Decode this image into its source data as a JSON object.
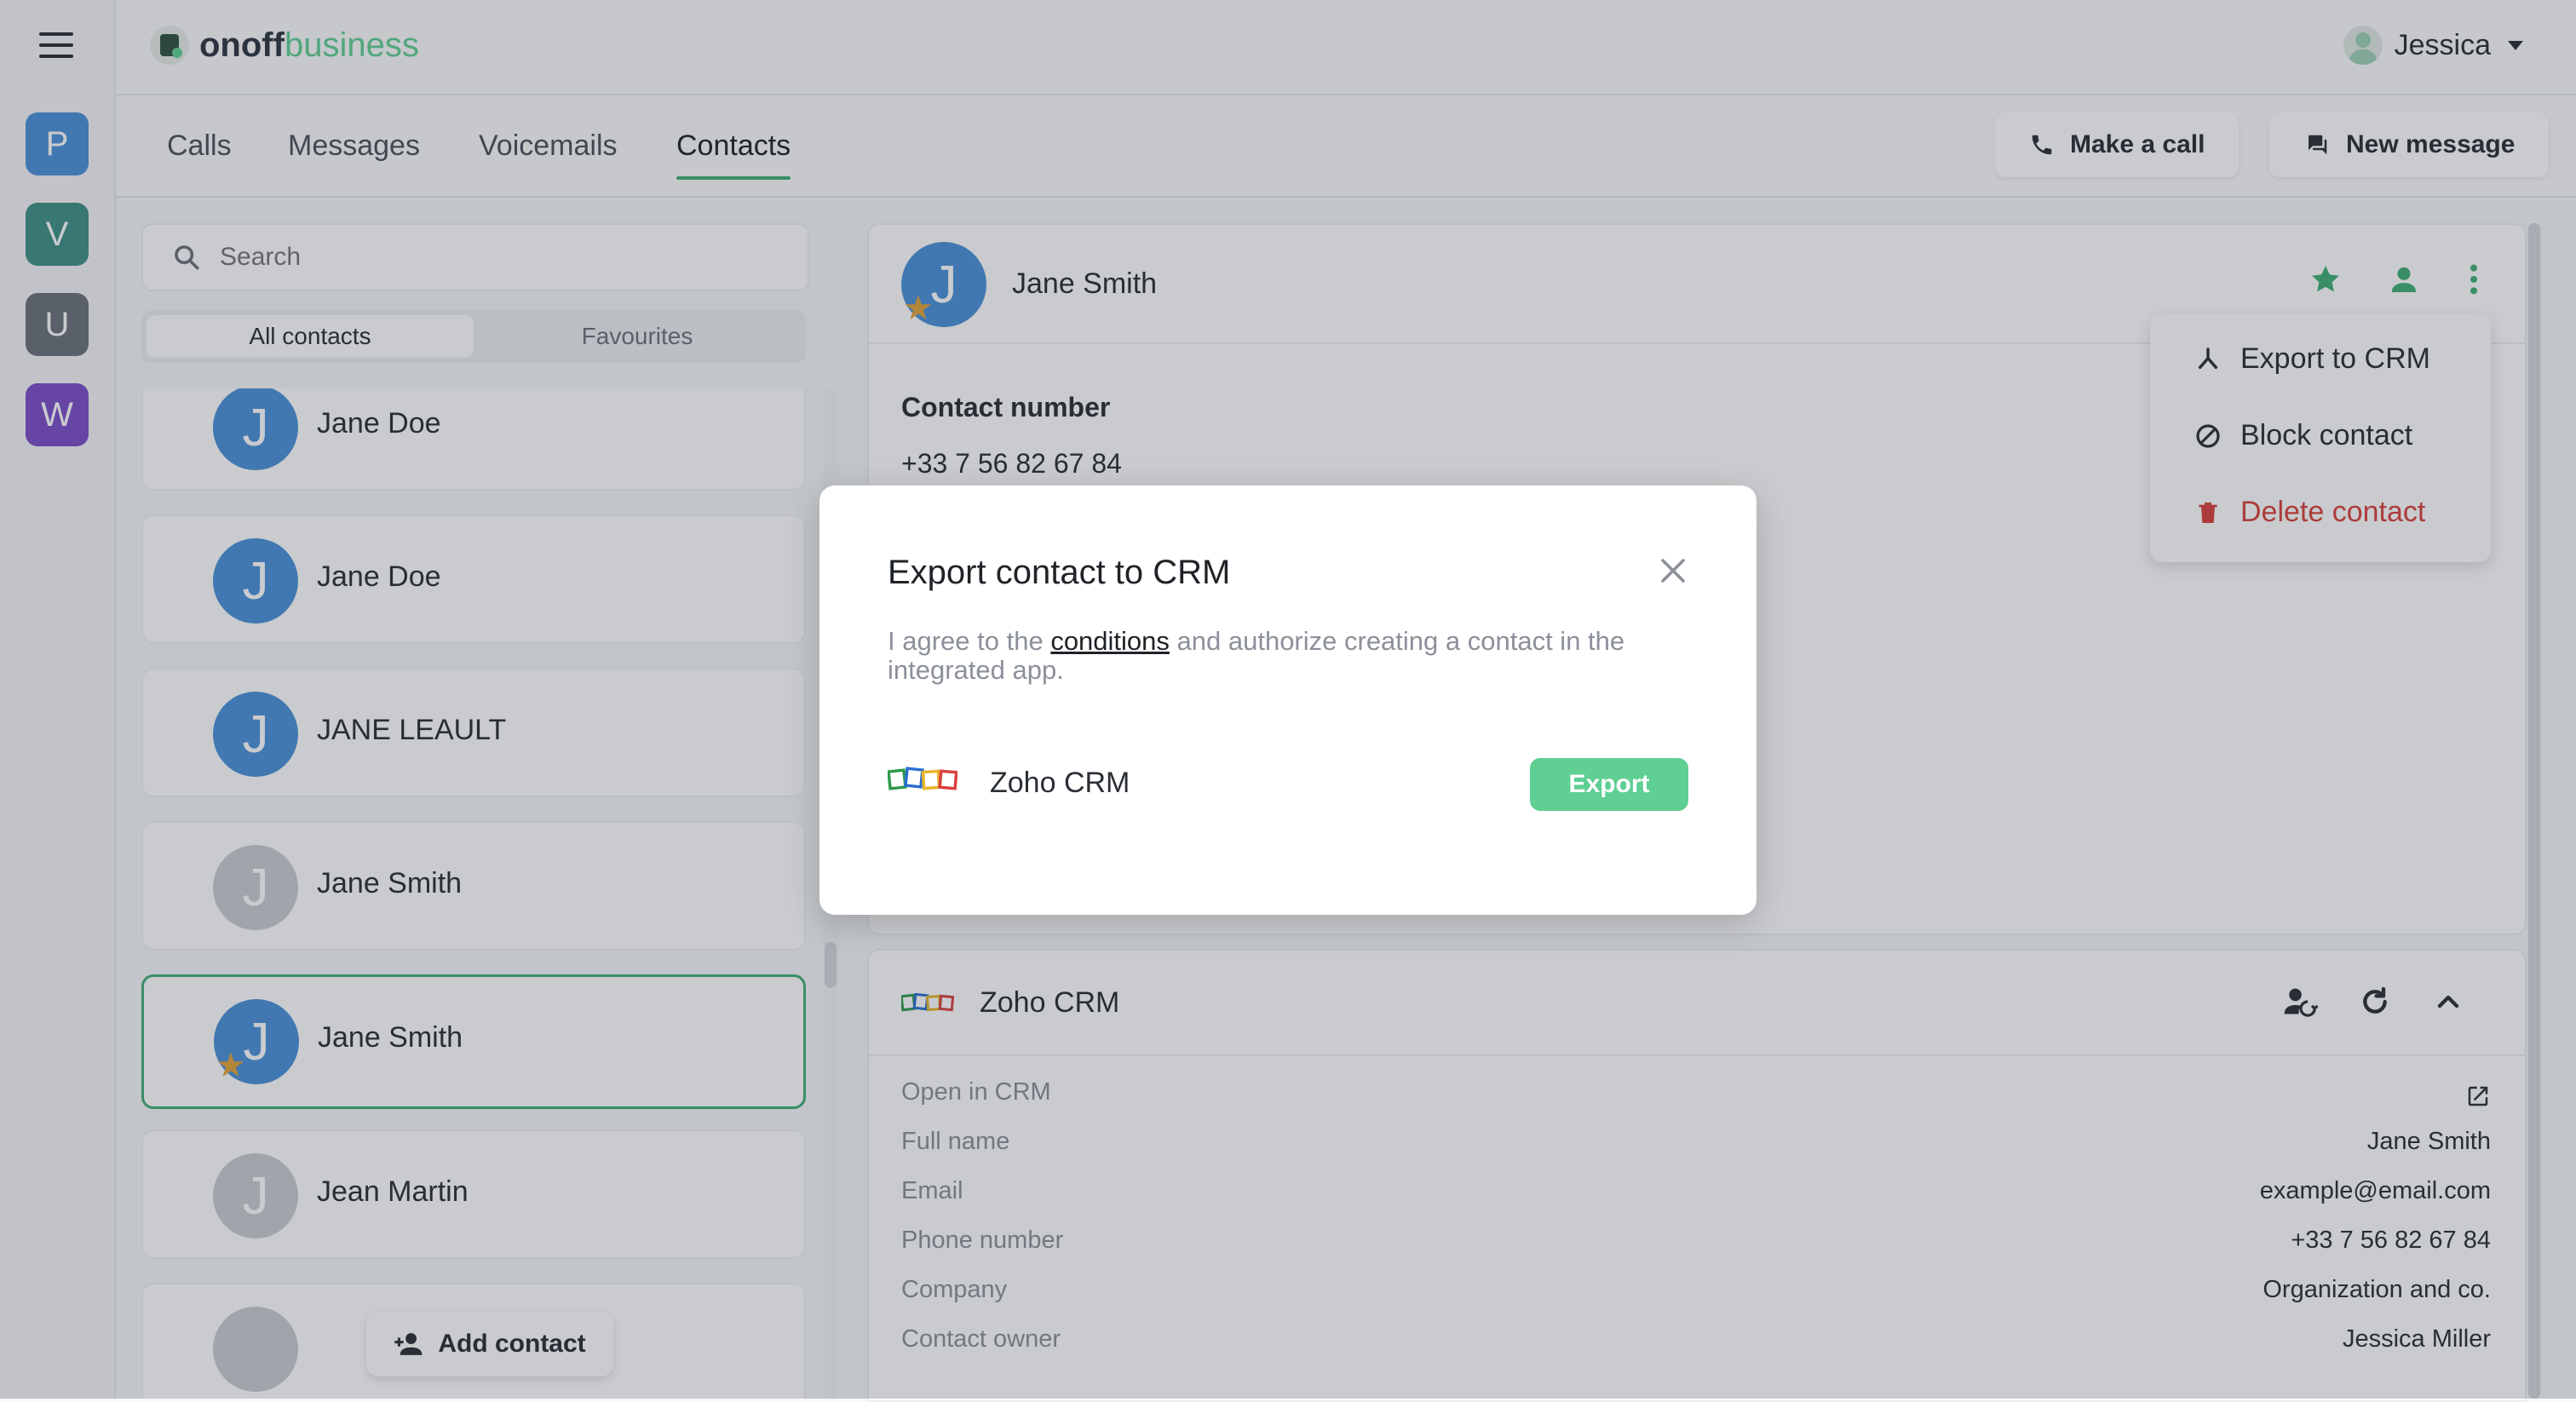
{
  "app": {
    "logo_main": "onoff",
    "logo_sub": "business",
    "user_name": "Jessica"
  },
  "workspaces": [
    {
      "letter": "P",
      "color": "#4a90d9"
    },
    {
      "letter": "V",
      "color": "#3f8f86"
    },
    {
      "letter": "U",
      "color": "#6b717a"
    },
    {
      "letter": "W",
      "color": "#7b4dc9"
    }
  ],
  "tabs": {
    "calls": "Calls",
    "messages": "Messages",
    "voicemails": "Voicemails",
    "contacts": "Contacts"
  },
  "actions": {
    "make_call": "Make a call",
    "new_message": "New message"
  },
  "search": {
    "placeholder": "Search"
  },
  "filters": {
    "all": "All contacts",
    "favourites": "Favourites"
  },
  "contacts": [
    {
      "name": "Jane Doe",
      "initial": "J",
      "color": "#4a90d9"
    },
    {
      "name": "Jane Doe",
      "initial": "J",
      "color": "#4a90d9"
    },
    {
      "name": "JANE LEAULT",
      "initial": "J",
      "color": "#4a90d9"
    },
    {
      "name": "Jane Smith",
      "initial": "J",
      "color": "#c9ccd1"
    },
    {
      "name": "Jane Smith",
      "initial": "J",
      "color": "#4a90d9"
    },
    {
      "name": "Jean Martin",
      "initial": "J",
      "color": "#c9ccd1"
    }
  ],
  "add_contact": "Add contact",
  "detail": {
    "name": "Jane Smith",
    "initial": "J",
    "contact_number_label": "Contact number",
    "contact_number": "+33 7 56 82 67 84"
  },
  "menu": {
    "export": "Export to CRM",
    "block": "Block contact",
    "delete": "Delete contact"
  },
  "crm": {
    "title": "Zoho CRM",
    "rows": [
      {
        "k": "Open in CRM",
        "v": ""
      },
      {
        "k": "Full name",
        "v": "Jane Smith"
      },
      {
        "k": "Email",
        "v": "example@email.com"
      },
      {
        "k": "Phone number",
        "v": "+33 7 56 82 67 84"
      },
      {
        "k": "Company",
        "v": "Organization and co."
      },
      {
        "k": "Contact owner",
        "v": "Jessica Miller"
      }
    ]
  },
  "modal": {
    "title": "Export contact to CRM",
    "text_before": "I agree to the ",
    "link": "conditions",
    "text_after": " and authorize creating a contact in the integrated app.",
    "crm_name": "Zoho CRM",
    "export_label": "Export"
  }
}
